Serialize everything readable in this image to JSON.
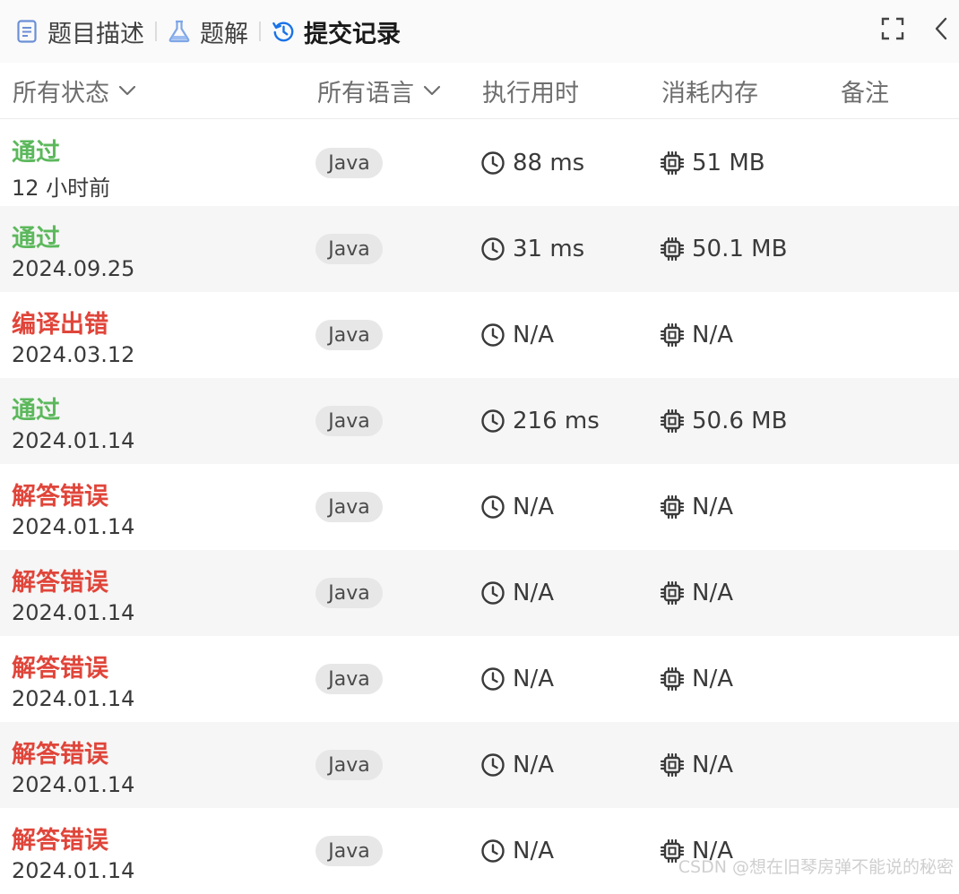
{
  "tabs": [
    {
      "label": "题目描述",
      "icon": "document-icon",
      "active": false
    },
    {
      "label": "题解",
      "icon": "flask-icon",
      "active": false
    },
    {
      "label": "提交记录",
      "icon": "history-icon",
      "active": true
    }
  ],
  "toolbar": {
    "fullscreen_icon": "fullscreen-icon",
    "collapse_icon": "chevron-left-icon"
  },
  "columns": {
    "status": "所有状态",
    "language": "所有语言",
    "runtime": "执行用时",
    "memory": "消耗内存",
    "notes": "备注"
  },
  "submissions": [
    {
      "status": "通过",
      "result": "accepted",
      "time": "12 小时前",
      "lang": "Java",
      "runtime": "88 ms",
      "memory": "51 MB"
    },
    {
      "status": "通过",
      "result": "accepted",
      "time": "2024.09.25",
      "lang": "Java",
      "runtime": "31 ms",
      "memory": "50.1 MB"
    },
    {
      "status": "编译出错",
      "result": "error",
      "time": "2024.03.12",
      "lang": "Java",
      "runtime": "N/A",
      "memory": "N/A"
    },
    {
      "status": "通过",
      "result": "accepted",
      "time": "2024.01.14",
      "lang": "Java",
      "runtime": "216 ms",
      "memory": "50.6 MB"
    },
    {
      "status": "解答错误",
      "result": "error",
      "time": "2024.01.14",
      "lang": "Java",
      "runtime": "N/A",
      "memory": "N/A"
    },
    {
      "status": "解答错误",
      "result": "error",
      "time": "2024.01.14",
      "lang": "Java",
      "runtime": "N/A",
      "memory": "N/A"
    },
    {
      "status": "解答错误",
      "result": "error",
      "time": "2024.01.14",
      "lang": "Java",
      "runtime": "N/A",
      "memory": "N/A"
    },
    {
      "status": "解答错误",
      "result": "error",
      "time": "2024.01.14",
      "lang": "Java",
      "runtime": "N/A",
      "memory": "N/A"
    },
    {
      "status": "解答错误",
      "result": "error",
      "time": "2024.01.14",
      "lang": "Java",
      "runtime": "N/A",
      "memory": "N/A"
    }
  ],
  "colors": {
    "accepted": "#5cb85c",
    "error": "#e0453a",
    "active_tab_icon": "#1a73e8"
  },
  "watermark": "CSDN @想在旧琴房弹不能说的秘密"
}
